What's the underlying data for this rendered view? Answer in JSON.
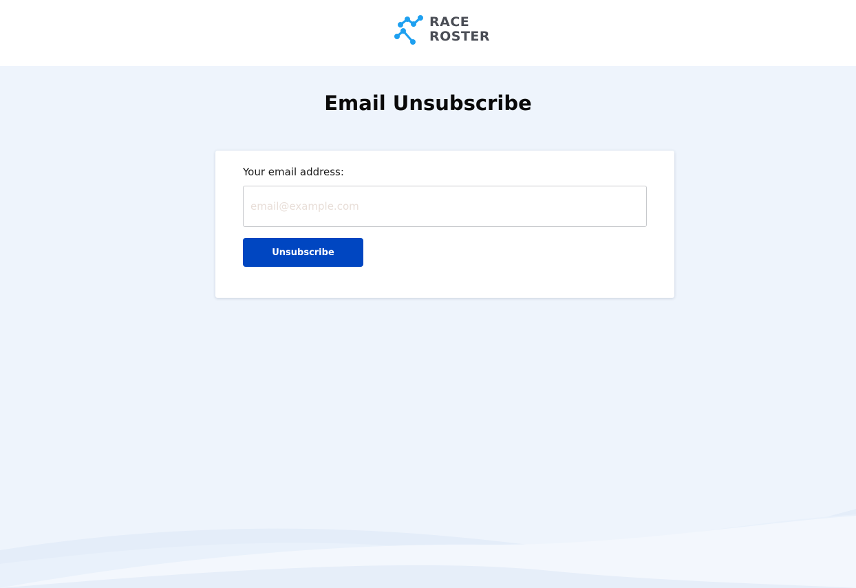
{
  "header": {
    "logo": {
      "icon": "race-roster-logo-mark",
      "line1": "RACE",
      "line2": "ROSTER"
    }
  },
  "main": {
    "title": "Email Unsubscribe",
    "form": {
      "email_label": "Your email address:",
      "email_value": "",
      "email_placeholder": "email@example.com",
      "submit_label": "Unsubscribe"
    }
  },
  "colors": {
    "page_background": "#eef4fc",
    "button": "#0046c1",
    "logo_blue": "#1ea0f0",
    "logo_text": "#4a4d55"
  }
}
